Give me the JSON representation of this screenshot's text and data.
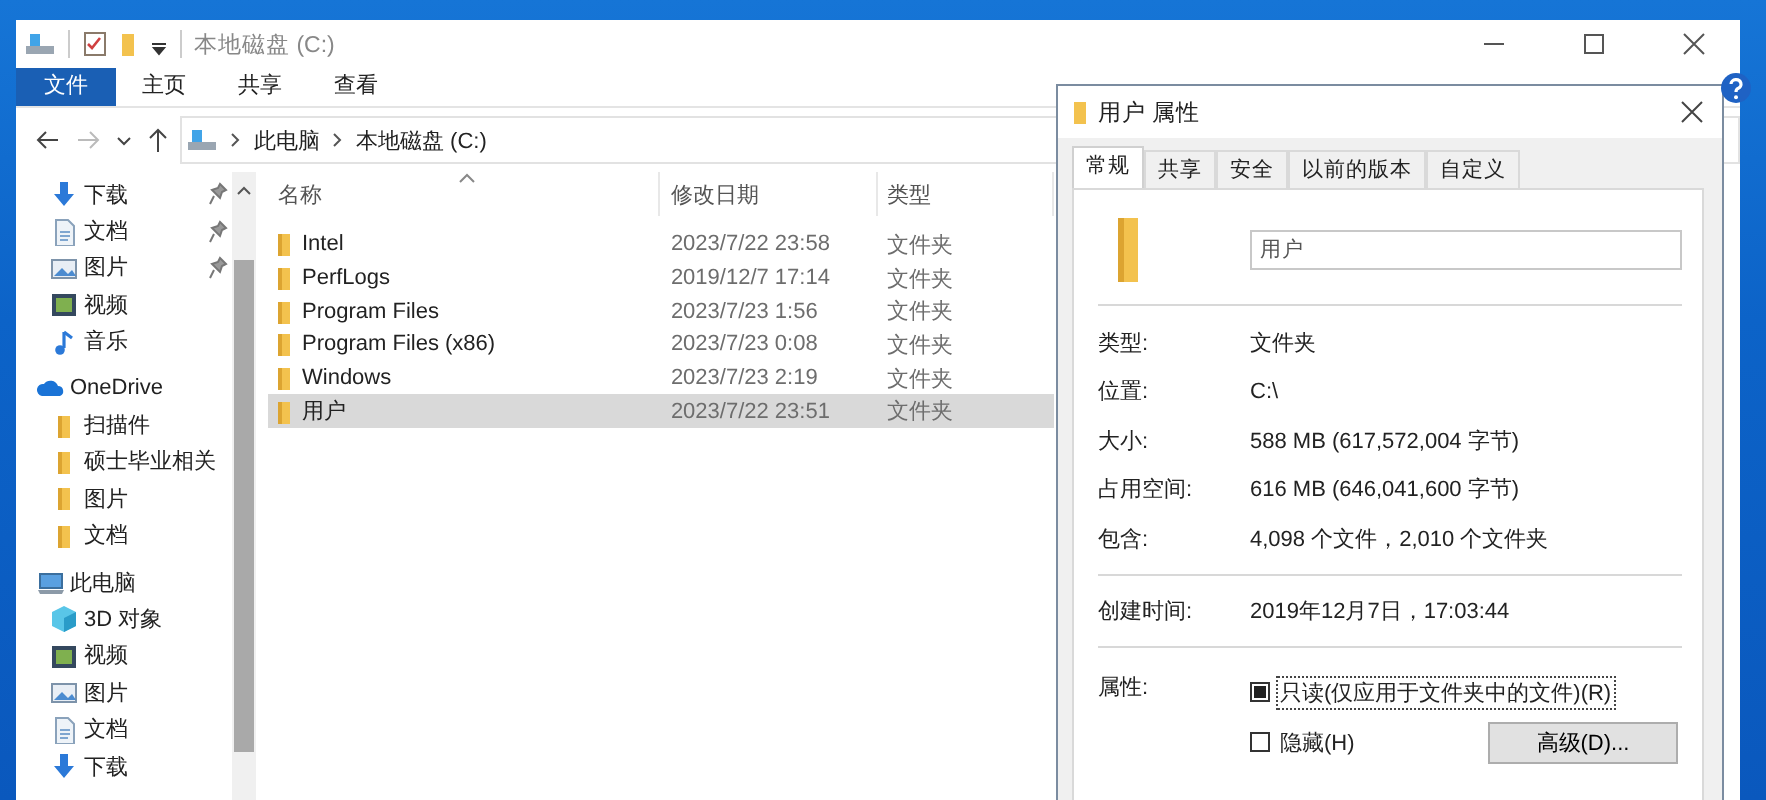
{
  "explorer": {
    "title": "本地磁盘 (C:)",
    "ribbon_tabs": [
      {
        "label": "文件",
        "selected": true
      },
      {
        "label": "主页",
        "selected": false
      },
      {
        "label": "共享",
        "selected": false
      },
      {
        "label": "查看",
        "selected": false
      }
    ],
    "breadcrumb": [
      "此电脑",
      "本地磁盘 (C:)"
    ],
    "navigation": [
      {
        "label": "下载",
        "kind": "download",
        "pinned": true
      },
      {
        "label": "文档",
        "kind": "document",
        "pinned": true
      },
      {
        "label": "图片",
        "kind": "picture",
        "pinned": true
      },
      {
        "label": "视频",
        "kind": "video",
        "pinned": false
      },
      {
        "label": "音乐",
        "kind": "music",
        "pinned": false
      },
      {
        "label": "OneDrive",
        "kind": "cloud",
        "pinned": false,
        "children": [
          {
            "label": "扫描件",
            "kind": "folder"
          },
          {
            "label": "硕士毕业相关",
            "kind": "folder"
          },
          {
            "label": "图片",
            "kind": "folder"
          },
          {
            "label": "文档",
            "kind": "folder"
          }
        ]
      },
      {
        "label": "此电脑",
        "kind": "computer",
        "pinned": false,
        "children": [
          {
            "label": "3D 对象",
            "kind": "cube"
          },
          {
            "label": "视频",
            "kind": "video"
          },
          {
            "label": "图片",
            "kind": "picture"
          },
          {
            "label": "文档",
            "kind": "document"
          },
          {
            "label": "下载",
            "kind": "download"
          }
        ]
      }
    ],
    "columns": [
      {
        "label": "名称",
        "sorted": true
      },
      {
        "label": "修改日期",
        "sorted": false
      },
      {
        "label": "类型",
        "sorted": false
      }
    ],
    "rows": [
      {
        "name": "Intel",
        "date": "2023/7/22 23:58",
        "type": "文件夹",
        "selected": false
      },
      {
        "name": "PerfLogs",
        "date": "2019/12/7 17:14",
        "type": "文件夹",
        "selected": false
      },
      {
        "name": "Program Files",
        "date": "2023/7/23 1:56",
        "type": "文件夹",
        "selected": false
      },
      {
        "name": "Program Files (x86)",
        "date": "2023/7/23 0:08",
        "type": "文件夹",
        "selected": false
      },
      {
        "name": "Windows",
        "date": "2023/7/23 2:19",
        "type": "文件夹",
        "selected": false
      },
      {
        "name": "用户",
        "date": "2023/7/22 23:51",
        "type": "文件夹",
        "selected": true
      }
    ]
  },
  "dialog": {
    "title": "用户 属性",
    "tabs": [
      {
        "label": "常规",
        "selected": true
      },
      {
        "label": "共享",
        "selected": false
      },
      {
        "label": "安全",
        "selected": false
      },
      {
        "label": "以前的版本",
        "selected": false
      },
      {
        "label": "自定义",
        "selected": false
      }
    ],
    "name_field": {
      "value": "用户"
    },
    "property_groups": [
      [
        {
          "label": "类型:",
          "value": "文件夹"
        },
        {
          "label": "位置:",
          "value": "C:\\"
        },
        {
          "label": "大小:",
          "value": "588 MB (617,572,004 字节)"
        },
        {
          "label": "占用空间:",
          "value": "616 MB (646,041,600 字节)"
        },
        {
          "label": "包含:",
          "value": "4,098 个文件，2,010 个文件夹"
        }
      ],
      [
        {
          "label": "创建时间:",
          "value": "2019年12月7日，17:03:44"
        }
      ]
    ],
    "attributes_label": "属性:",
    "attributes": [
      {
        "label": "只读(仅应用于文件夹中的文件)(R)",
        "checked": false,
        "indeterminate": true,
        "focused": true
      },
      {
        "label": "隐藏(H)",
        "checked": false,
        "indeterminate": false,
        "focused": false
      }
    ],
    "advanced_button": "高级(D)..."
  }
}
